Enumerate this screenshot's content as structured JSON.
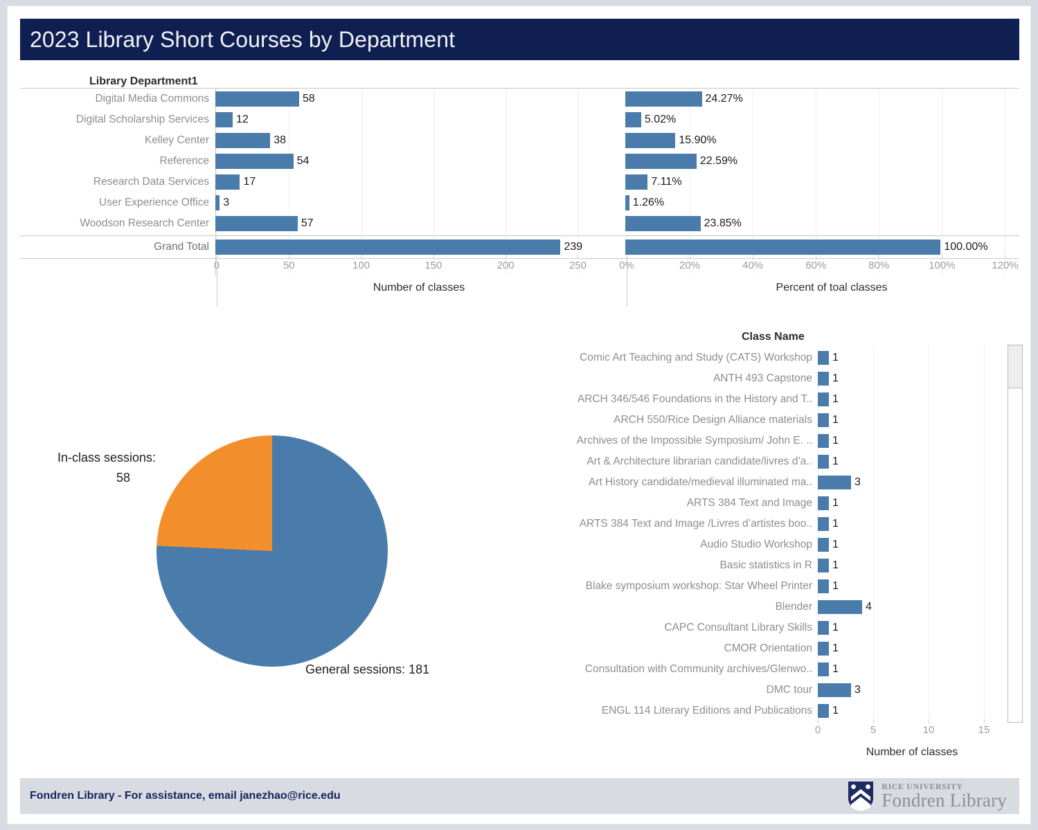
{
  "header": {
    "title": "2023 Library Short Courses by Department"
  },
  "dept_panel": {
    "caption": "Library Department1",
    "count_axis_title": "Number of classes",
    "pct_axis_title": "Percent of toal classes",
    "count_ticks": [
      "0",
      "50",
      "100",
      "150",
      "200",
      "250"
    ],
    "pct_ticks": [
      "0%",
      "20%",
      "40%",
      "60%",
      "80%",
      "100%",
      "120%"
    ]
  },
  "pie_panel": {
    "left_label": "In-class sessions:",
    "left_value": "58",
    "bottom_label": "General sessions:  181"
  },
  "class_panel": {
    "caption": "Class Name",
    "axis_title": "Number of classes",
    "ticks": [
      "0",
      "5",
      "10",
      "15"
    ]
  },
  "footer": {
    "text": "Fondren Library - For assistance, email janezhao@rice.edu",
    "logo_top": "RICE UNIVERSITY",
    "logo_main": "Fondren Library"
  },
  "colors": {
    "header_navy": "#101f52",
    "bar_blue": "#4a7cab",
    "pie_orange": "#f28e2c",
    "footer_band": "#d8dbe2",
    "page_background": "#d8dbe2"
  },
  "chart_data": [
    {
      "type": "bar",
      "title": "Library Department1",
      "orientation": "horizontal",
      "grid": true,
      "xlabel": "Number of classes",
      "ylabel": "",
      "xlim": [
        0,
        280
      ],
      "categories": [
        "Digital Media Commons",
        "Digital Scholarship Services",
        "Kelley Center",
        "Reference",
        "Research Data Services",
        "User Experience Office",
        "Woodson Research Center",
        "Grand Total"
      ],
      "values": [
        58,
        12,
        38,
        54,
        17,
        3,
        57,
        239
      ],
      "value_labels": [
        "58",
        "12",
        "38",
        "54",
        "17",
        "3",
        "57",
        "239"
      ],
      "tick_labels": [
        "0",
        "50",
        "100",
        "150",
        "200",
        "250"
      ]
    },
    {
      "type": "bar",
      "title": "Percent of toal classes",
      "orientation": "horizontal",
      "grid": true,
      "xlabel": "Percent of toal classes",
      "ylabel": "",
      "xlim": [
        0,
        130
      ],
      "categories": [
        "Digital Media Commons",
        "Digital Scholarship Services",
        "Kelley Center",
        "Reference",
        "Research Data Services",
        "User Experience Office",
        "Woodson Research Center",
        "Grand Total"
      ],
      "values": [
        24.27,
        5.02,
        15.9,
        22.59,
        7.11,
        1.26,
        23.85,
        100.0
      ],
      "value_labels": [
        "24.27%",
        "5.02%",
        "15.90%",
        "22.59%",
        "7.11%",
        "1.26%",
        "23.85%",
        "100.00%"
      ],
      "tick_labels": [
        "0%",
        "20%",
        "40%",
        "60%",
        "80%",
        "100%",
        "120%"
      ]
    },
    {
      "type": "pie",
      "title": "",
      "labels": [
        "General sessions",
        "In-class sessions"
      ],
      "values": [
        181,
        58
      ],
      "annotations": [
        "General sessions:  181",
        "In-class sessions: 58"
      ],
      "colors": [
        "#4a7cab",
        "#f28e2c"
      ]
    },
    {
      "type": "bar",
      "title": "Class Name",
      "orientation": "horizontal",
      "grid": true,
      "xlabel": "Number of classes",
      "ylabel": "",
      "xlim": [
        0,
        17
      ],
      "tick_labels": [
        "0",
        "5",
        "10",
        "15"
      ],
      "categories": [
        "Comic Art Teaching and Study (CATS) Workshop",
        "ANTH 493 Capstone",
        "ARCH 346/546 Foundations in the History and T..",
        "ARCH 550/Rice Design Alliance materials",
        "Archives of the Impossible Symposium/ John E. ..",
        "Art & Architecture librarian candidate/livres d’a..",
        "Art History candidate/medieval illuminated ma..",
        "ARTS 384 Text and Image",
        "ARTS 384 Text and Image /Livres d’artistes boo..",
        "Audio Studio Workshop",
        "Basic statistics in R",
        "Blake symposium workshop: Star Wheel Printer",
        "Blender",
        "CAPC Consultant Library Skills",
        "CMOR Orientation",
        "Consultation with Community archives/Glenwo..",
        "DMC tour",
        "ENGL 114 Literary Editions and Publications"
      ],
      "values": [
        1,
        1,
        1,
        1,
        1,
        1,
        3,
        1,
        1,
        1,
        1,
        1,
        4,
        1,
        1,
        1,
        3,
        1
      ],
      "value_labels": [
        "1",
        "1",
        "1",
        "1",
        "1",
        "1",
        "3",
        "1",
        "1",
        "1",
        "1",
        "1",
        "4",
        "1",
        "1",
        "1",
        "3",
        "1"
      ],
      "scrollable": true
    }
  ],
  "dept_rows": [
    {
      "label": "Digital Media Commons",
      "count": "58",
      "count_val": 58,
      "pct": "24.27%",
      "pct_val": 24.27
    },
    {
      "label": "Digital Scholarship Services",
      "count": "12",
      "count_val": 12,
      "pct": "5.02%",
      "pct_val": 5.02
    },
    {
      "label": "Kelley Center",
      "count": "38",
      "count_val": 38,
      "pct": "15.90%",
      "pct_val": 15.9
    },
    {
      "label": "Reference",
      "count": "54",
      "count_val": 54,
      "pct": "22.59%",
      "pct_val": 22.59
    },
    {
      "label": "Research Data Services",
      "count": "17",
      "count_val": 17,
      "pct": "7.11%",
      "pct_val": 7.11
    },
    {
      "label": "User Experience Office",
      "count": "3",
      "count_val": 3,
      "pct": "1.26%",
      "pct_val": 1.26
    },
    {
      "label": "Woodson Research Center",
      "count": "57",
      "count_val": 57,
      "pct": "23.85%",
      "pct_val": 23.85
    }
  ],
  "grand_total_row": {
    "label": "Grand Total",
    "count": "239",
    "count_val": 239,
    "pct": "100.00%",
    "pct_val": 100.0
  },
  "class_rows": [
    {
      "label": "Comic Art Teaching and Study (CATS) Workshop",
      "value": "1",
      "val": 1
    },
    {
      "label": "ANTH 493 Capstone",
      "value": "1",
      "val": 1
    },
    {
      "label": "ARCH 346/546 Foundations in the History and T..",
      "value": "1",
      "val": 1
    },
    {
      "label": "ARCH 550/Rice Design Alliance materials",
      "value": "1",
      "val": 1
    },
    {
      "label": "Archives of the Impossible Symposium/ John E. ..",
      "value": "1",
      "val": 1
    },
    {
      "label": "Art & Architecture librarian candidate/livres d’a..",
      "value": "1",
      "val": 1
    },
    {
      "label": "Art History candidate/medieval illuminated ma..",
      "value": "3",
      "val": 3
    },
    {
      "label": "ARTS 384 Text and Image",
      "value": "1",
      "val": 1
    },
    {
      "label": "ARTS 384 Text and Image /Livres d’artistes boo..",
      "value": "1",
      "val": 1
    },
    {
      "label": "Audio Studio Workshop",
      "value": "1",
      "val": 1
    },
    {
      "label": "Basic statistics in R",
      "value": "1",
      "val": 1
    },
    {
      "label": "Blake symposium workshop: Star Wheel Printer",
      "value": "1",
      "val": 1
    },
    {
      "label": "Blender",
      "value": "4",
      "val": 4
    },
    {
      "label": "CAPC Consultant Library Skills",
      "value": "1",
      "val": 1
    },
    {
      "label": "CMOR Orientation",
      "value": "1",
      "val": 1
    },
    {
      "label": "Consultation with Community archives/Glenwo..",
      "value": "1",
      "val": 1
    },
    {
      "label": "DMC tour",
      "value": "3",
      "val": 3
    },
    {
      "label": "ENGL 114 Literary Editions and Publications",
      "value": "1",
      "val": 1
    }
  ]
}
